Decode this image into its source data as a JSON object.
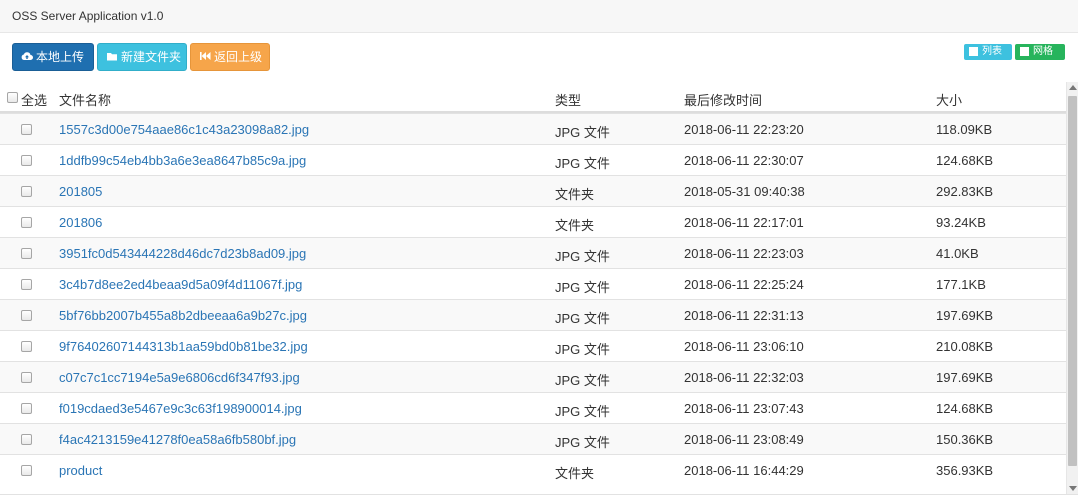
{
  "app": {
    "title": "OSS Server Application v1.0"
  },
  "toolbar": {
    "upload_label": "本地上传",
    "new_folder_label": "新建文件夹",
    "back_label": "返回上级",
    "colors": {
      "upload": "#1f6fb0",
      "new_folder": "#3dc1df",
      "back": "#f6a54a"
    },
    "icons": {
      "upload": "cloud-upload-icon",
      "new_folder": "folder-icon",
      "back": "fast-backward-icon"
    }
  },
  "view_toggle": {
    "list_label": "列表",
    "grid_label": "网格",
    "colors": {
      "list": "#3dc1df",
      "grid": "#27b45c"
    }
  },
  "table": {
    "headers": {
      "select_all": "全选",
      "name": "文件名称",
      "type": "类型",
      "modified": "最后修改时间",
      "size": "大小"
    },
    "rows": [
      {
        "name": "1557c3d00e754aae86c1c43a23098a82.jpg",
        "type": "JPG 文件",
        "modified": "2018-06-11 22:23:20",
        "size": "118.09KB"
      },
      {
        "name": "1ddfb99c54eb4bb3a6e3ea8647b85c9a.jpg",
        "type": "JPG 文件",
        "modified": "2018-06-11 22:30:07",
        "size": "124.68KB"
      },
      {
        "name": "201805",
        "type": "文件夹",
        "modified": "2018-05-31 09:40:38",
        "size": "292.83KB"
      },
      {
        "name": "201806",
        "type": "文件夹",
        "modified": "2018-06-11 22:17:01",
        "size": "93.24KB"
      },
      {
        "name": "3951fc0d543444228d46dc7d23b8ad09.jpg",
        "type": "JPG 文件",
        "modified": "2018-06-11 22:23:03",
        "size": "41.0KB"
      },
      {
        "name": "3c4b7d8ee2ed4beaa9d5a09f4d11067f.jpg",
        "type": "JPG 文件",
        "modified": "2018-06-11 22:25:24",
        "size": "177.1KB"
      },
      {
        "name": "5bf76bb2007b455a8b2dbeeaa6a9b27c.jpg",
        "type": "JPG 文件",
        "modified": "2018-06-11 22:31:13",
        "size": "197.69KB"
      },
      {
        "name": "9f76402607144313b1aa59bd0b81be32.jpg",
        "type": "JPG 文件",
        "modified": "2018-06-11 23:06:10",
        "size": "210.08KB"
      },
      {
        "name": "c07c7c1cc7194e5a9e6806cd6f347f93.jpg",
        "type": "JPG 文件",
        "modified": "2018-06-11 22:32:03",
        "size": "197.69KB"
      },
      {
        "name": "f019cdaed3e5467e9c3c63f198900014.jpg",
        "type": "JPG 文件",
        "modified": "2018-06-11 23:07:43",
        "size": "124.68KB"
      },
      {
        "name": "f4ac4213159e41278f0ea58a6fb580bf.jpg",
        "type": "JPG 文件",
        "modified": "2018-06-11 23:08:49",
        "size": "150.36KB"
      },
      {
        "name": "product",
        "type": "文件夹",
        "modified": "2018-06-11 16:44:29",
        "size": "356.93KB"
      }
    ]
  }
}
